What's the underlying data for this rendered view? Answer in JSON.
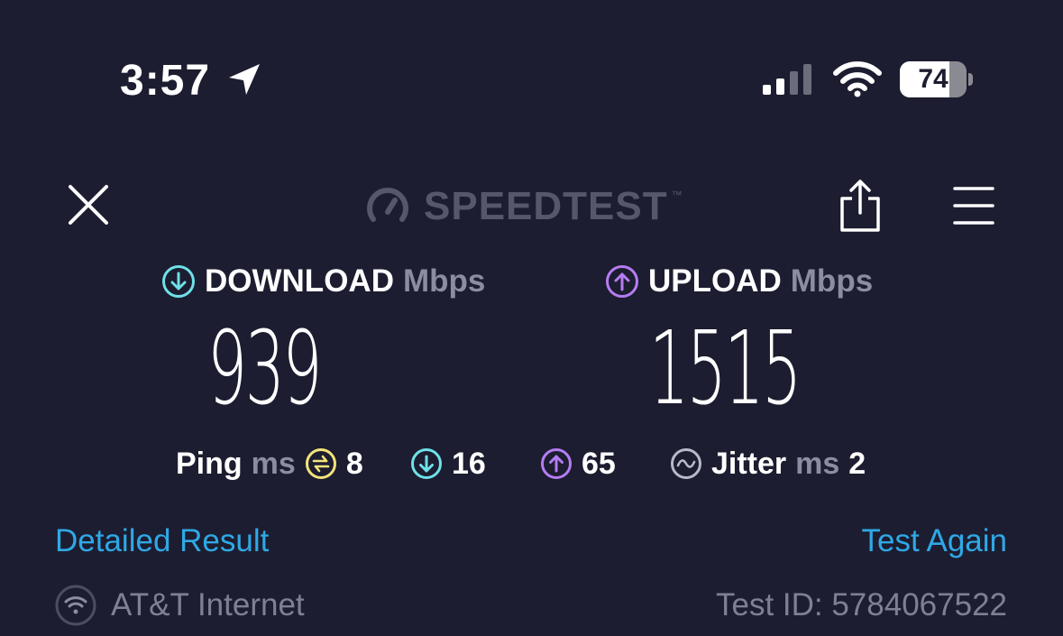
{
  "status_bar": {
    "time": "3:57",
    "battery_level": 74,
    "battery_text": "74"
  },
  "header": {
    "logo_text": "SPEEDTEST",
    "logo_mark": "™",
    "close_icon": "close-icon",
    "share_icon": "share-icon",
    "menu_icon": "menu-icon"
  },
  "download": {
    "label": "DOWNLOAD",
    "unit": "Mbps",
    "value": "939"
  },
  "upload": {
    "label": "UPLOAD",
    "unit": "Mbps",
    "value": "1515"
  },
  "ping": {
    "label": "Ping",
    "unit": "ms",
    "idle": "8",
    "download": "16",
    "upload": "65"
  },
  "jitter": {
    "label": "Jitter",
    "unit": "ms",
    "value": "2"
  },
  "links": {
    "detailed_result": "Detailed Result",
    "test_again": "Test Again"
  },
  "footer": {
    "isp": "AT&T Internet",
    "test_id": "Test ID: 5784067522"
  },
  "colors": {
    "background": "#1c1d30",
    "download_accent": "#6fe0e8",
    "upload_accent": "#b57cf2",
    "ping_accent": "#f2e37a",
    "link": "#2fa8e6",
    "muted": "#8b8da3"
  }
}
